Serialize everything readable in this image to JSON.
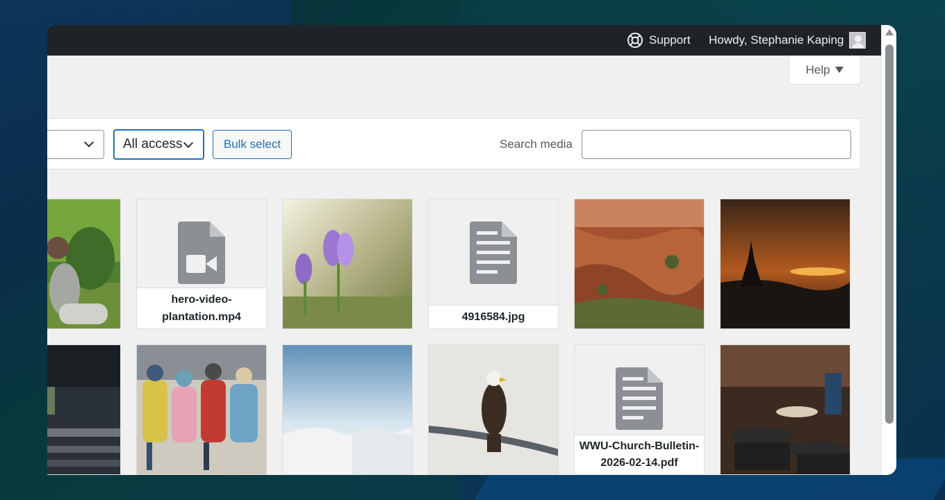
{
  "adminbar": {
    "support_label": "Support",
    "howdy_label": "Howdy, Stephanie Kaping"
  },
  "help": {
    "label": "Help"
  },
  "toolbar": {
    "filter_access": "All access",
    "bulk_select": "Bulk select",
    "search_label": "Search media",
    "search_value": ""
  },
  "media": [
    {
      "kind": "image",
      "icon": "photo-person-icon"
    },
    {
      "kind": "video",
      "icon": "video-file-icon",
      "filename": "hero-video-plantation.mp4"
    },
    {
      "kind": "image",
      "icon": "photo-crocus-icon"
    },
    {
      "kind": "document",
      "icon": "document-file-icon",
      "filename": "4916584.jpg"
    },
    {
      "kind": "image",
      "icon": "photo-canyon-icon"
    },
    {
      "kind": "image",
      "icon": "photo-sunset-icon"
    },
    {
      "kind": "image",
      "icon": "photo-stage-icon"
    },
    {
      "kind": "image",
      "icon": "photo-children-icon"
    },
    {
      "kind": "image",
      "icon": "photo-snow-icon"
    },
    {
      "kind": "image",
      "icon": "photo-eagle-icon"
    },
    {
      "kind": "document",
      "icon": "document-file-icon",
      "filename": "WWU-Church-Bulletin-2026-02-14.pdf"
    },
    {
      "kind": "image",
      "icon": "photo-buffet-icon"
    }
  ]
}
